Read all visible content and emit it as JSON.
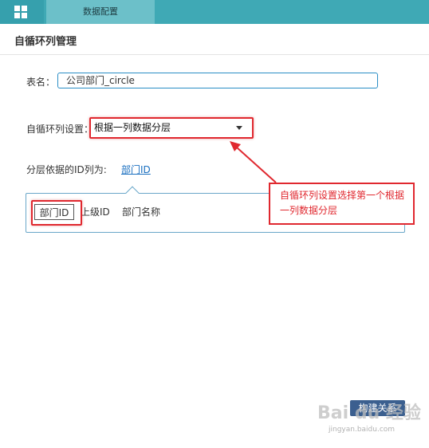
{
  "header": {
    "tab_label": "数据配置"
  },
  "page": {
    "title": "自循环列管理"
  },
  "form": {
    "table_name_label": "表名：",
    "table_name_value": "公司部门_circle",
    "loop_setting_label": "自循环列设置：",
    "loop_setting_value": "根据一列数据分层",
    "layer_id_label": "分层依据的ID列为:",
    "layer_id_value": "部门ID"
  },
  "columns": [
    "部门ID",
    "上级ID",
    "部门名称"
  ],
  "annotation": {
    "callout_text": "自循环列设置选择第一个根据一列数据分层"
  },
  "actions": {
    "build_label": "构建关系"
  },
  "watermark": {
    "main": "Bai du 经验",
    "sub": "jingyan.baidu.com"
  },
  "colors": {
    "topbar": "#3fa9b5",
    "tab_active": "#6cc0c9",
    "accent_red": "#e0282f",
    "link": "#1a6fc0",
    "button": "#3b5f8f"
  },
  "icons": {
    "app_menu": "grid-icon",
    "dropdown": "caret-down-icon"
  }
}
